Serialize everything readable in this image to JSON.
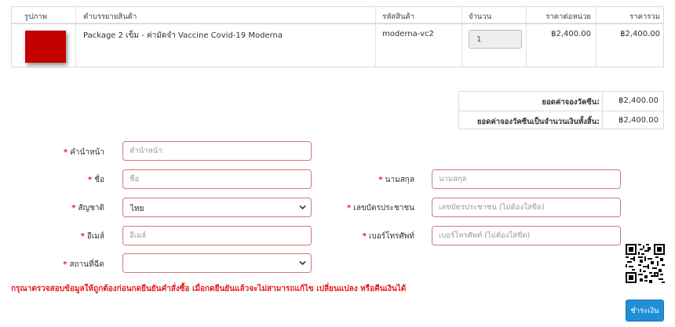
{
  "table": {
    "headers": {
      "image": "รูปภาพ",
      "description": "คำบรรยายสินค้า",
      "code": "รหัสสินค้า",
      "quantity": "จำนวน",
      "unit_price": "ราคาต่อหน่วย",
      "total": "ราคารวม"
    },
    "rows": [
      {
        "description": "Package 2 เข็ม - ค่ามัดจำ Vaccine Covid-19 Moderna",
        "code": "moderna-vc2",
        "quantity": "1",
        "unit_price": "฿2,400.00",
        "total": "฿2,400.00",
        "image_color": "#c40000"
      }
    ]
  },
  "summary": {
    "subtotal_label": "ยอดค่าจองวัคซีน:",
    "subtotal_value": "฿2,400.00",
    "grand_total_label": "ยอดค่าจองวัคซีนเป็นจำนวนเงินทั้งสิ้น:",
    "grand_total_value": "฿2,400.00"
  },
  "form": {
    "required_mark": "*",
    "title": {
      "label": "คำนำหน้า",
      "placeholder": "คำนำหน้า"
    },
    "first_name": {
      "label": "ชื่อ",
      "placeholder": "ชื่อ"
    },
    "last_name": {
      "label": "นามสกุล",
      "placeholder": "นามสกุล"
    },
    "nationality": {
      "label": "สัญชาติ",
      "value": "ไทย"
    },
    "id_number": {
      "label": "เลขบัตรประชาชน",
      "placeholder": "เลขบัตรประชาชน (ไม่ต้องใส่ขีด)"
    },
    "email": {
      "label": "อีเมล์",
      "placeholder": "อีเมล์"
    },
    "phone": {
      "label": "เบอร์โทรศัพท์",
      "placeholder": "เบอร์โทรศัพท์ (ไม่ต้องใส่ขีด)"
    },
    "location": {
      "label": "สถานที่ฉีด",
      "value": ""
    }
  },
  "warning": "กรุณาตรวจสอบข้อมูลให้ถูกต้องก่อนกดยืนยันคำสั่งซื้อ เมื่อกดยืนยันแล้วจะไม่สามารถแก้ไข เปลี่ยนแปลง หรือคืนเงินได้",
  "pay_button": "ชำระเงิน",
  "colors": {
    "accent": "#1f8fd6",
    "required": "#e02020",
    "warning": "#e31b1b",
    "input_border": "#d07a7a"
  },
  "icons": {
    "qr": "qr-code-icon",
    "select_arrow": "chevron-down-icon"
  }
}
